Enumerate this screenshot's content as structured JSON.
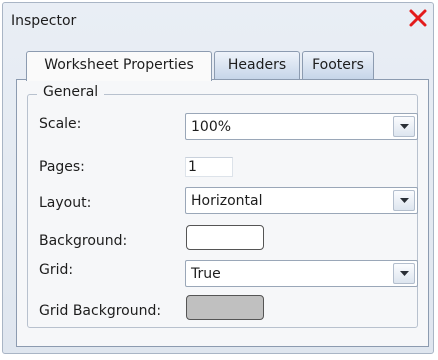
{
  "window": {
    "title": "Inspector",
    "close_icon": "close-icon",
    "close_color": "#e31b1b"
  },
  "tabs": [
    {
      "label": "Worksheet Properties",
      "active": true
    },
    {
      "label": "Headers",
      "active": false
    },
    {
      "label": "Footers",
      "active": false
    }
  ],
  "group": {
    "label": "General"
  },
  "fields": {
    "scale": {
      "label": "Scale:",
      "value": "100%"
    },
    "pages": {
      "label": "Pages:",
      "value": "1"
    },
    "layout": {
      "label": "Layout:",
      "value": "Horizontal"
    },
    "background": {
      "label": "Background:",
      "color": "#ffffff"
    },
    "grid": {
      "label": "Grid:",
      "value": "True"
    },
    "grid_background": {
      "label": "Grid Background:",
      "color": "#c0c0c0"
    }
  },
  "icons": {
    "dropdown": "chevron-down-icon"
  }
}
